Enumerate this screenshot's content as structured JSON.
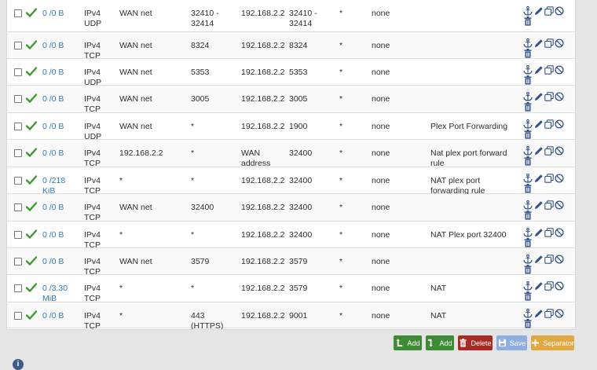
{
  "rules": [
    {
      "traffic": "0 /0 B",
      "protocol": "IPv4 UDP",
      "source": "WAN net",
      "ports": "32410 - 32414",
      "dest": "192.168.2.2",
      "dest_ports": "32410 - 32414",
      "gateway": "*",
      "queue": "none",
      "description": ""
    },
    {
      "traffic": "0 /0 B",
      "protocol": "IPv4 TCP",
      "source": "WAN net",
      "ports": "8324",
      "dest": "192.168.2.2",
      "dest_ports": "8324",
      "gateway": "*",
      "queue": "none",
      "description": ""
    },
    {
      "traffic": "0 /0 B",
      "protocol": "IPv4 UDP",
      "source": "WAN net",
      "ports": "5353",
      "dest": "192.168.2.2",
      "dest_ports": "5353",
      "gateway": "*",
      "queue": "none",
      "description": ""
    },
    {
      "traffic": "0 /0 B",
      "protocol": "IPv4 TCP",
      "source": "WAN net",
      "ports": "3005",
      "dest": "192.168.2.2",
      "dest_ports": "3005",
      "gateway": "*",
      "queue": "none",
      "description": ""
    },
    {
      "traffic": "0 /0 B",
      "protocol": "IPv4 UDP",
      "source": "WAN net",
      "ports": "*",
      "dest": "192.168.2.2",
      "dest_ports": "1900",
      "gateway": "*",
      "queue": "none",
      "description": "Plex Port Forwarding"
    },
    {
      "traffic": "0 /0 B",
      "protocol": "IPv4 TCP",
      "source": "192.168.2.2",
      "ports": "*",
      "dest": "WAN address",
      "dest_ports": "32400",
      "gateway": "*",
      "queue": "none",
      "description": "Nat plex port forward rule"
    },
    {
      "traffic": "0 /218 KiB",
      "protocol": "IPv4 TCP",
      "source": "*",
      "ports": "*",
      "dest": "192.168.2.2",
      "dest_ports": "32400",
      "gateway": "*",
      "queue": "none",
      "description": "NAT plex port forwarding rule"
    },
    {
      "traffic": "0 /0 B",
      "protocol": "IPv4 TCP",
      "source": "WAN net",
      "ports": "32400",
      "dest": "192.168.2.2",
      "dest_ports": "32400",
      "gateway": "*",
      "queue": "none",
      "description": ""
    },
    {
      "traffic": "0 /0 B",
      "protocol": "IPv4 TCP",
      "source": "*",
      "ports": "*",
      "dest": "192.168.2.2",
      "dest_ports": "32400",
      "gateway": "*",
      "queue": "none",
      "description": "NAT Plex port 32400"
    },
    {
      "traffic": "0 /0 B",
      "protocol": "IPv4 TCP",
      "source": "WAN net",
      "ports": "3579",
      "dest": "192.168.2.2",
      "dest_ports": "3579",
      "gateway": "*",
      "queue": "none",
      "description": ""
    },
    {
      "traffic": "0 /3.30 MiB",
      "protocol": "IPv4 TCP",
      "source": "*",
      "ports": "*",
      "dest": "192.168.2.2",
      "dest_ports": "3579",
      "gateway": "*",
      "queue": "none",
      "description": "NAT"
    },
    {
      "traffic": "0 /0 B",
      "protocol": "IPv4 TCP",
      "source": "*",
      "ports": "443 (HTTPS)",
      "dest": "192.168.2.2",
      "dest_ports": "9001",
      "gateway": "*",
      "queue": "none",
      "description": "NAT"
    }
  ],
  "buttons": {
    "add_top": "Add",
    "add_bottom": "Add",
    "delete": "Delete",
    "save": "Save",
    "separator": "Separator"
  },
  "icons": {
    "enabled": "check-icon",
    "anchor": "anchor-icon",
    "edit": "pencil-icon",
    "copy": "copy-icon",
    "disable": "ban-icon",
    "delete": "trash-icon",
    "info": "info-icon"
  },
  "colors": {
    "link": "#317ab8",
    "check": "#3c9a2e",
    "add": "#3f8a34",
    "delete": "#a82a24",
    "save": "#8eaee0",
    "separator": "#e0a843",
    "icon": "#30528d"
  }
}
